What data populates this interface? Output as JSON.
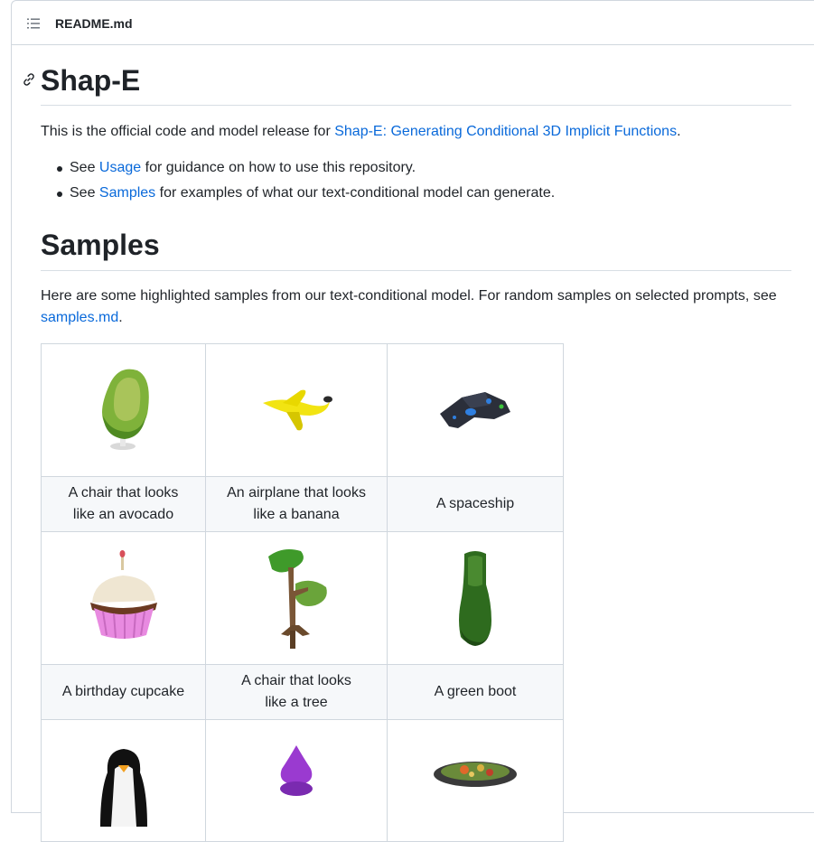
{
  "file_header": {
    "file_name": "README.md",
    "toc_icon": "list-unordered-icon"
  },
  "readme": {
    "title": "Shap-E",
    "intro": {
      "before": "This is the official code and model release for ",
      "link": "Shap-E: Generating Conditional 3D Implicit Functions",
      "after": "."
    },
    "bullets": [
      {
        "before": "See ",
        "link": "Usage",
        "after": " for guidance on how to use this repository."
      },
      {
        "before": "See ",
        "link": "Samples",
        "after": " for examples of what our text-conditional model can generate."
      }
    ],
    "samples_heading": "Samples",
    "samples_intro": {
      "before": "Here are some highlighted samples from our text-conditional model. For random samples on selected prompts, see ",
      "link": "samples.md",
      "after": "."
    },
    "samples": [
      {
        "caption": "A chair that looks\nlike an avocado",
        "image": "avocado-chair"
      },
      {
        "caption": "An airplane that looks\nlike a banana",
        "image": "banana-airplane"
      },
      {
        "caption": "A spaceship",
        "image": "spaceship"
      },
      {
        "caption": "A birthday cupcake",
        "image": "birthday-cupcake"
      },
      {
        "caption": "A chair that looks\nlike a tree",
        "image": "tree-chair"
      },
      {
        "caption": "A green boot",
        "image": "green-boot"
      },
      {
        "caption": "",
        "image": "penguin"
      },
      {
        "caption": "",
        "image": "purple-object"
      },
      {
        "caption": "",
        "image": "food-bowl"
      }
    ]
  }
}
